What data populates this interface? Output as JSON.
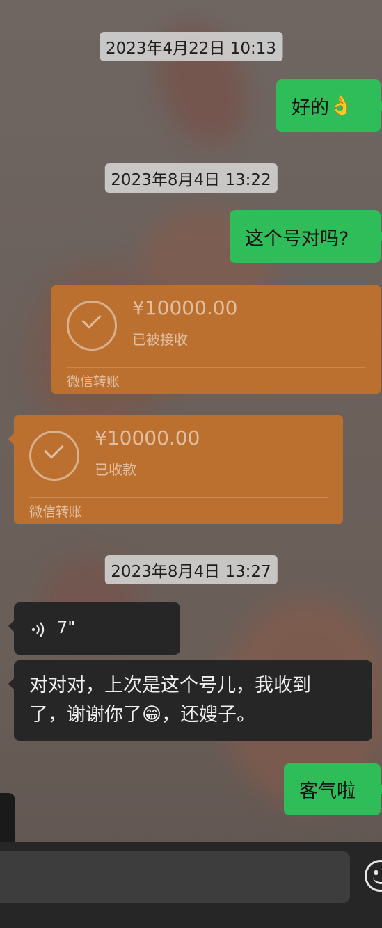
{
  "timestamps": [
    "2023年4月22日 10:13",
    "2023年8月4日 13:22",
    "2023年8月4日 13:27"
  ],
  "messages": {
    "m1": {
      "text": "好的",
      "emoji": "👌"
    },
    "m2": {
      "text": "这个号对吗?"
    },
    "t1": {
      "amount": "¥10000.00",
      "status": "已被接收",
      "label": "微信转账"
    },
    "t2": {
      "amount": "¥10000.00",
      "status": "已收款",
      "label": "微信转账"
    },
    "voice": {
      "duration": "7\""
    },
    "m3": {
      "line1": "对对对，上次是这个号儿，我收到",
      "line2_pre": "了，谢谢你了",
      "emoji": "😁",
      "line2_post": "，还嫂子。"
    },
    "m4": {
      "text": "客气啦"
    }
  },
  "colors": {
    "outgoing": "#2fbd5a",
    "transfer": "#bb7030",
    "incoming": "#262626"
  },
  "icons": {
    "emoji_button": "emoji-icon",
    "voice": "voice-wave-icon",
    "transfer": "check-circle-icon"
  }
}
